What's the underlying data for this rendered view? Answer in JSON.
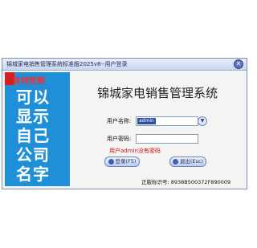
{
  "window": {
    "title": "锦城家电销售管理系统标准版2025v8--用户登录",
    "close_glyph": "✕"
  },
  "banner": {
    "ribbon_text": "支持定制",
    "lines": [
      "可以",
      "显示",
      "自己",
      "公司",
      "名字"
    ]
  },
  "app_title": "锦城家电销售管理系统",
  "form": {
    "username_label": "用户名称:",
    "username_value": "admin",
    "password_label": "用户密码:",
    "password_value": "",
    "error_message": "用户admin没有密码"
  },
  "buttons": {
    "login_label": "登录(F5)",
    "exit_label": "退出(Esc)"
  },
  "serial_text": "正版标识号: 8938B500372F890009"
}
